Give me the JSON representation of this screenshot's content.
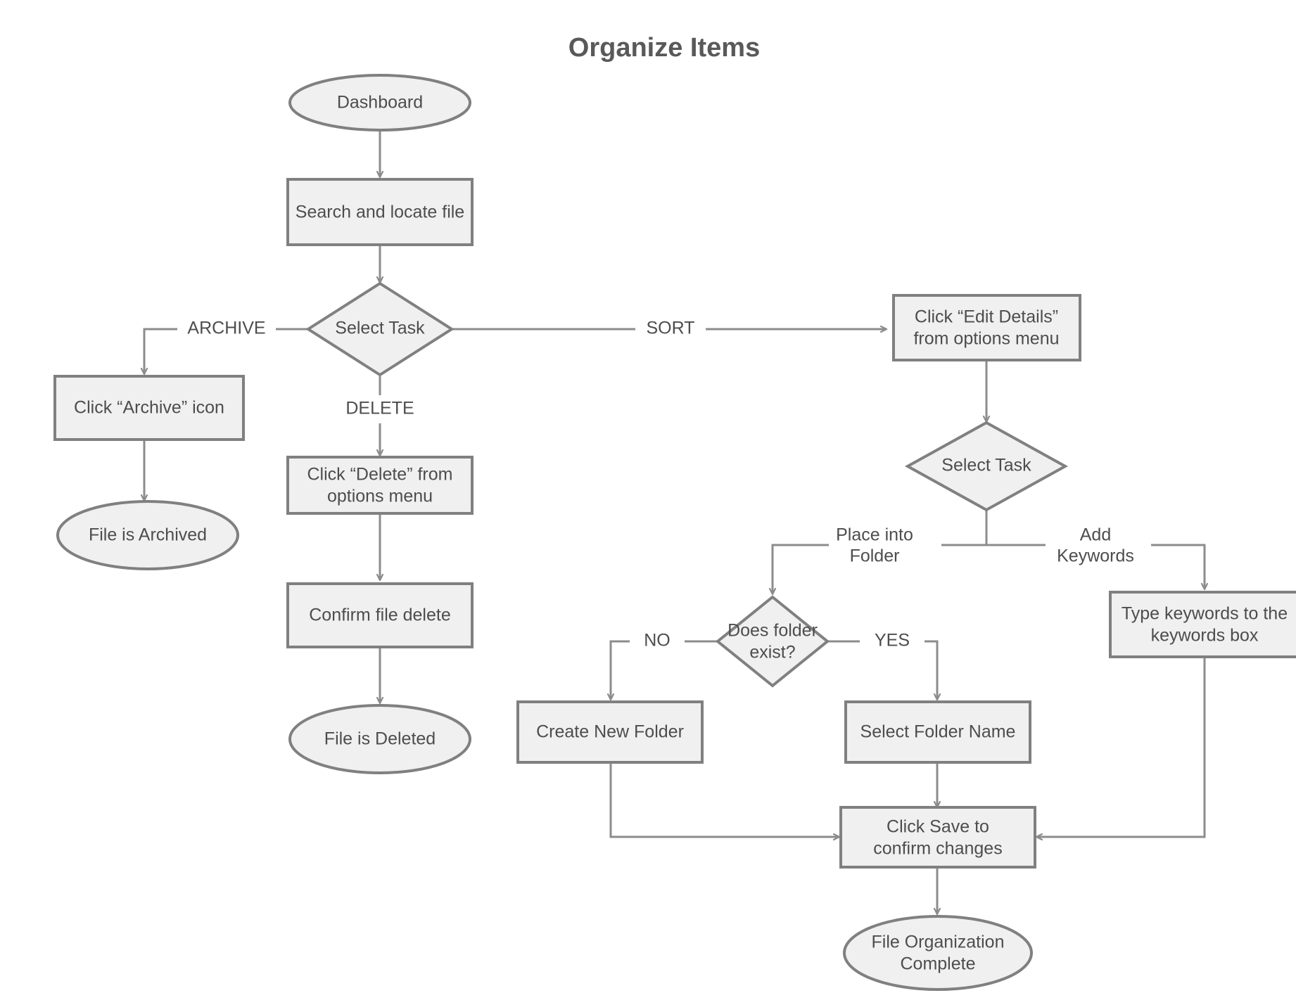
{
  "diagram": {
    "title": "Organize Items",
    "colors": {
      "node_fill": "#f0f0f0",
      "node_stroke": "#808080",
      "edge_stroke": "#8c8c8c",
      "text": "#4d4d4d",
      "title": "#595959",
      "background": "#ffffff"
    },
    "nodes": [
      {
        "id": "dashboard",
        "type": "terminator",
        "lines": [
          "Dashboard"
        ]
      },
      {
        "id": "search",
        "type": "process",
        "lines": [
          "Search and locate file"
        ]
      },
      {
        "id": "select_task_1",
        "type": "decision",
        "lines": [
          "Select Task"
        ]
      },
      {
        "id": "click_archive",
        "type": "process",
        "lines": [
          "Click “Archive” icon"
        ]
      },
      {
        "id": "file_archived",
        "type": "terminator",
        "lines": [
          "File is Archived"
        ]
      },
      {
        "id": "click_delete",
        "type": "process",
        "lines": [
          "Click “Delete” from",
          "options menu"
        ]
      },
      {
        "id": "confirm_delete",
        "type": "process",
        "lines": [
          "Confirm file delete"
        ]
      },
      {
        "id": "file_deleted",
        "type": "terminator",
        "lines": [
          "File is Deleted"
        ]
      },
      {
        "id": "edit_details",
        "type": "process",
        "lines": [
          "Click “Edit Details”",
          "from options menu"
        ]
      },
      {
        "id": "select_task_2",
        "type": "decision",
        "lines": [
          "Select Task"
        ]
      },
      {
        "id": "folder_exist",
        "type": "decision",
        "lines": [
          "Does folder",
          "exist?"
        ]
      },
      {
        "id": "create_folder",
        "type": "process",
        "lines": [
          "Create New Folder"
        ]
      },
      {
        "id": "select_folder",
        "type": "process",
        "lines": [
          "Select Folder Name"
        ]
      },
      {
        "id": "type_keywords",
        "type": "process",
        "lines": [
          "Type keywords to the",
          "keywords box"
        ]
      },
      {
        "id": "click_save",
        "type": "process",
        "lines": [
          "Click Save to",
          "confirm changes"
        ]
      },
      {
        "id": "complete",
        "type": "terminator",
        "lines": [
          "File Organization",
          "Complete"
        ]
      }
    ],
    "edge_labels": [
      {
        "id": "archive",
        "lines": [
          "ARCHIVE"
        ]
      },
      {
        "id": "delete",
        "lines": [
          "DELETE"
        ]
      },
      {
        "id": "sort",
        "lines": [
          "SORT"
        ]
      },
      {
        "id": "place_folder",
        "lines": [
          "Place into",
          "Folder"
        ]
      },
      {
        "id": "add_keywords",
        "lines": [
          "Add",
          "Keywords"
        ]
      },
      {
        "id": "no",
        "lines": [
          "NO"
        ]
      },
      {
        "id": "yes",
        "lines": [
          "YES"
        ]
      }
    ]
  }
}
